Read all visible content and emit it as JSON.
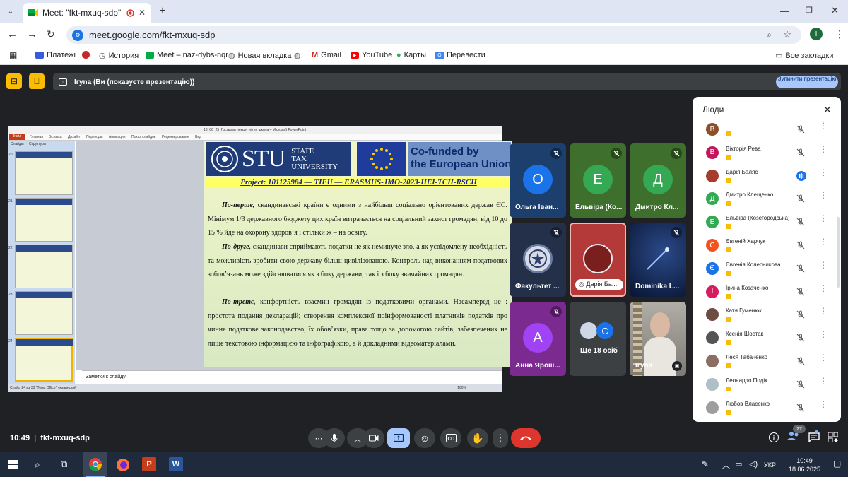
{
  "browser": {
    "tab_title": "Meet: \"fkt-mxuq-sdp\"",
    "url": "meet.google.com/fkt-mxuq-sdp",
    "profile_initial": "I",
    "bookmarks": [
      "Платежі",
      "История",
      "Meet – naz-dybs-nqr",
      "Новая вкладка",
      "Gmail",
      "YouTube",
      "Карты",
      "Перевести"
    ],
    "all_bookmarks": "Все закладки"
  },
  "meet": {
    "presenting_label": "Ігуna (Ви (показуєте презентацію))",
    "stop_presenting": "Зупинити презентацію",
    "meeting_time": "10:49",
    "meeting_code": "fkt-mxuq-sdp",
    "participants_badge": "27",
    "tiles": [
      {
        "name": "Ольга Іван...",
        "initial": "О",
        "color": "#1a73e8",
        "bg": "#1d3f6e"
      },
      {
        "name": "Ельвіра (Ко...",
        "initial": "Е",
        "color": "#34a853",
        "bg": "#3e6f2c"
      },
      {
        "name": "Дмитро Кл...",
        "initial": "Д",
        "color": "#34a853",
        "bg": "#3e6f2c"
      },
      {
        "name": "Факультет ...",
        "initial": "",
        "color": "#ffffff",
        "bg": "#24304a"
      },
      {
        "name": "Дарія Ба...",
        "initial": "",
        "color": "#a33",
        "bg": "#b43a3a"
      },
      {
        "name": "Dominika L...",
        "initial": "",
        "color": "#0a1a3a",
        "bg": "#102046"
      },
      {
        "name": "Анна Ярош...",
        "initial": "А",
        "color": "#a142f4",
        "bg": "#7b2a8f"
      },
      {
        "name": "Ще 18 осіб",
        "initial": "Є",
        "color": "#1a73e8",
        "bg": "#3c4043"
      },
      {
        "name": "Ігуna",
        "initial": "",
        "color": "#ccc",
        "bg": "#9a9a94"
      }
    ]
  },
  "people_panel": {
    "title": "Люди",
    "rows": [
      {
        "name": "",
        "initial": "В",
        "color": "#8d4e2a"
      },
      {
        "name": "Вікторія Рева",
        "initial": "В",
        "color": "#c2185b"
      },
      {
        "name": "Дарія Баляс",
        "initial": "",
        "color": "#a63c2e"
      },
      {
        "name": "Дмитро Клещенко",
        "initial": "Д",
        "color": "#34a853"
      },
      {
        "name": "Ельвіра (Козегородська)",
        "initial": "Е",
        "color": "#34a853"
      },
      {
        "name": "Євгеній Харчук",
        "initial": "Є",
        "color": "#f4511e"
      },
      {
        "name": "Євгенія Колесникова",
        "initial": "Є",
        "color": "#1a73e8"
      },
      {
        "name": "Ірина Козаченко",
        "initial": "І",
        "color": "#d81b60"
      },
      {
        "name": "Катя Гуменюк",
        "initial": "",
        "color": "#6d4c41"
      },
      {
        "name": "Ксенія Шостак",
        "initial": "",
        "color": "#555"
      },
      {
        "name": "Леся Табаченко",
        "initial": "",
        "color": "#8d6e63"
      },
      {
        "name": "Леонардо Подік",
        "initial": "",
        "color": "#b0bec5"
      },
      {
        "name": "Любов Власенко",
        "initial": "",
        "color": "#9e9e9e"
      }
    ]
  },
  "ppt": {
    "window_title": "18_06_25_Гостьова лекція_літня школа – Microsoft PowerPoint",
    "ribbon": [
      "Файл",
      "Главная",
      "Вставка",
      "Дизайн",
      "Переходы",
      "Анимация",
      "Показ слайдов",
      "Рецензирование",
      "Вид"
    ],
    "panel_tabs": [
      "Слайды",
      "Структура"
    ],
    "thumb_numbers": [
      "20",
      "21",
      "22",
      "23",
      "24"
    ],
    "notes_placeholder": "Заметки к слайду",
    "status_left": "Слайд 24 из 33   \"Тема Office\"   украинский",
    "zoom": "100%",
    "slide": {
      "logo_line1": "STATE",
      "logo_line2": "TAX",
      "logo_line3": "UNIVERSITY",
      "logo_abbr": "STU",
      "eu_text": "Co-funded by\nthe European Union",
      "project": "Project: 101125984 — TIEU — ERASMUS-JMO-2023-HEI-TCH-RSCH",
      "p1_em": "По-перше,",
      "p1": " скандинавські країни є одними з найбільш соціально орієнтованих держав ЄС. Мінімум 1/3 державного бюджету цих країн витрачається на соціальний захист громадян, від 10 до 15 % йде на охорону здоров’я і стільки ж – на освіту.",
      "p2_em": "По-друге,",
      "p2": " скандинави сприймають податки не як неминуче зло, а як усвідомлену необхідність та можливість зробити свою державу більш цивілізованою. Контроль над виконанням податкових зобов’язань може здійснюватися як з боку держави, так і з боку звичайних громадян.",
      "p3_em": "По-третє,",
      "p3": " конфортність взаємин громадян із податковими органами. Насамперед це : простота подання декларацій; створення комплексної поінформованості платників податків про чинне податкове законодавство, їх обов’язки, права тощо за допомогою сайтів, забезпечених не лише текстовою інформацією та інфографікою, а й докладними відеоматеріалами."
    }
  },
  "taskbar": {
    "time": "10:49",
    "date": "18.06.2025",
    "lang": "УКР"
  }
}
